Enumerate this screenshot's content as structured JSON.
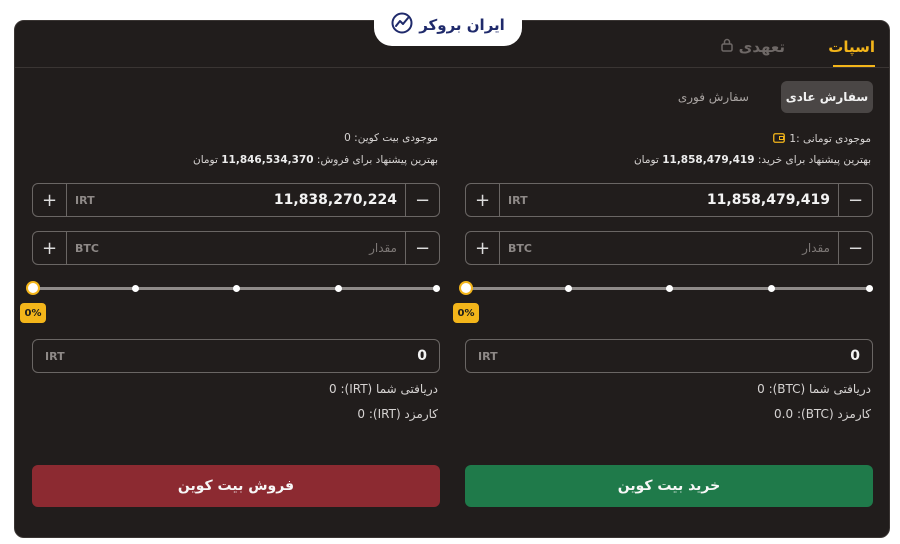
{
  "brand": {
    "name": "ایران بروکر"
  },
  "tabs": [
    {
      "label": "اسپات",
      "active": true
    },
    {
      "label": "تعهدی",
      "locked": true
    }
  ],
  "order_types": {
    "normal": "سفارش عادی",
    "instant": "سفارش فوری"
  },
  "buy": {
    "balance_label": "موجودی تومانی :1",
    "best_offer_label": "بهترین پیشنهاد برای خرید:",
    "best_offer_value": "11,858,479,419",
    "best_offer_unit": "تومان",
    "price_value": "11,858,479,419",
    "price_currency": "IRT",
    "amount_placeholder": "مقدار",
    "amount_currency": "BTC",
    "slider_percent": "0%",
    "slider_fraction": 0,
    "total_currency": "IRT",
    "total_value": "0",
    "receive_text": "دریافتی شما (BTC): 0",
    "fee_text": "کارمزد (BTC): 0.0",
    "action_label": "خرید بیت کوین"
  },
  "sell": {
    "balance_label": "موجودی بیت کوین: 0",
    "best_offer_label": "بهترین پیشنهاد برای فروش:",
    "best_offer_value": "11,846,534,370",
    "best_offer_unit": "تومان",
    "price_value": "11,838,270,224",
    "price_currency": "IRT",
    "amount_placeholder": "مقدار",
    "amount_currency": "BTC",
    "slider_percent": "0%",
    "slider_fraction": 0,
    "total_currency": "IRT",
    "total_value": "0",
    "receive_text": "دریافتی شما (IRT): 0",
    "fee_text": "کارمزد (IRT): 0",
    "action_label": "فروش بیت کوین"
  },
  "buttons": {
    "plus": "+",
    "minus": "−"
  },
  "colors": {
    "accent": "#f3b51a",
    "buy": "#1f7a4a",
    "sell": "#8c2a31",
    "panel": "#211d1c"
  }
}
